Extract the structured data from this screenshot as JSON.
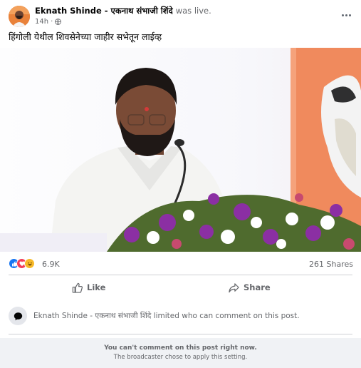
{
  "post": {
    "author": "Eknath Shinde - एकनाथ संभाजी शिंदे",
    "status": "was live.",
    "time": "14h",
    "caption": "हिंगोली येथील शिवसेनेच्या जाहीर सभेतून लाईव्ह"
  },
  "stats": {
    "reaction_count": "6.9K",
    "shares": "261 Shares",
    "reaction_icons": [
      "like-icon",
      "love-icon",
      "haha-icon"
    ]
  },
  "actions": {
    "like_label": "Like",
    "share_label": "Share"
  },
  "notice": {
    "author": "Eknath Shinde - एकनाथ संभाजी शिंदे",
    "text": "limited who can comment on this post."
  },
  "comment_blocked": {
    "title": "You can't comment on this post right now.",
    "subtitle": "The broadcaster chose to apply this setting."
  },
  "colors": {
    "like_blue": "#1877f2",
    "love_red": "#f33e58",
    "haha_yellow": "#f7b928",
    "muted_text": "#65676b",
    "banner_orange": "#f08a5d"
  }
}
